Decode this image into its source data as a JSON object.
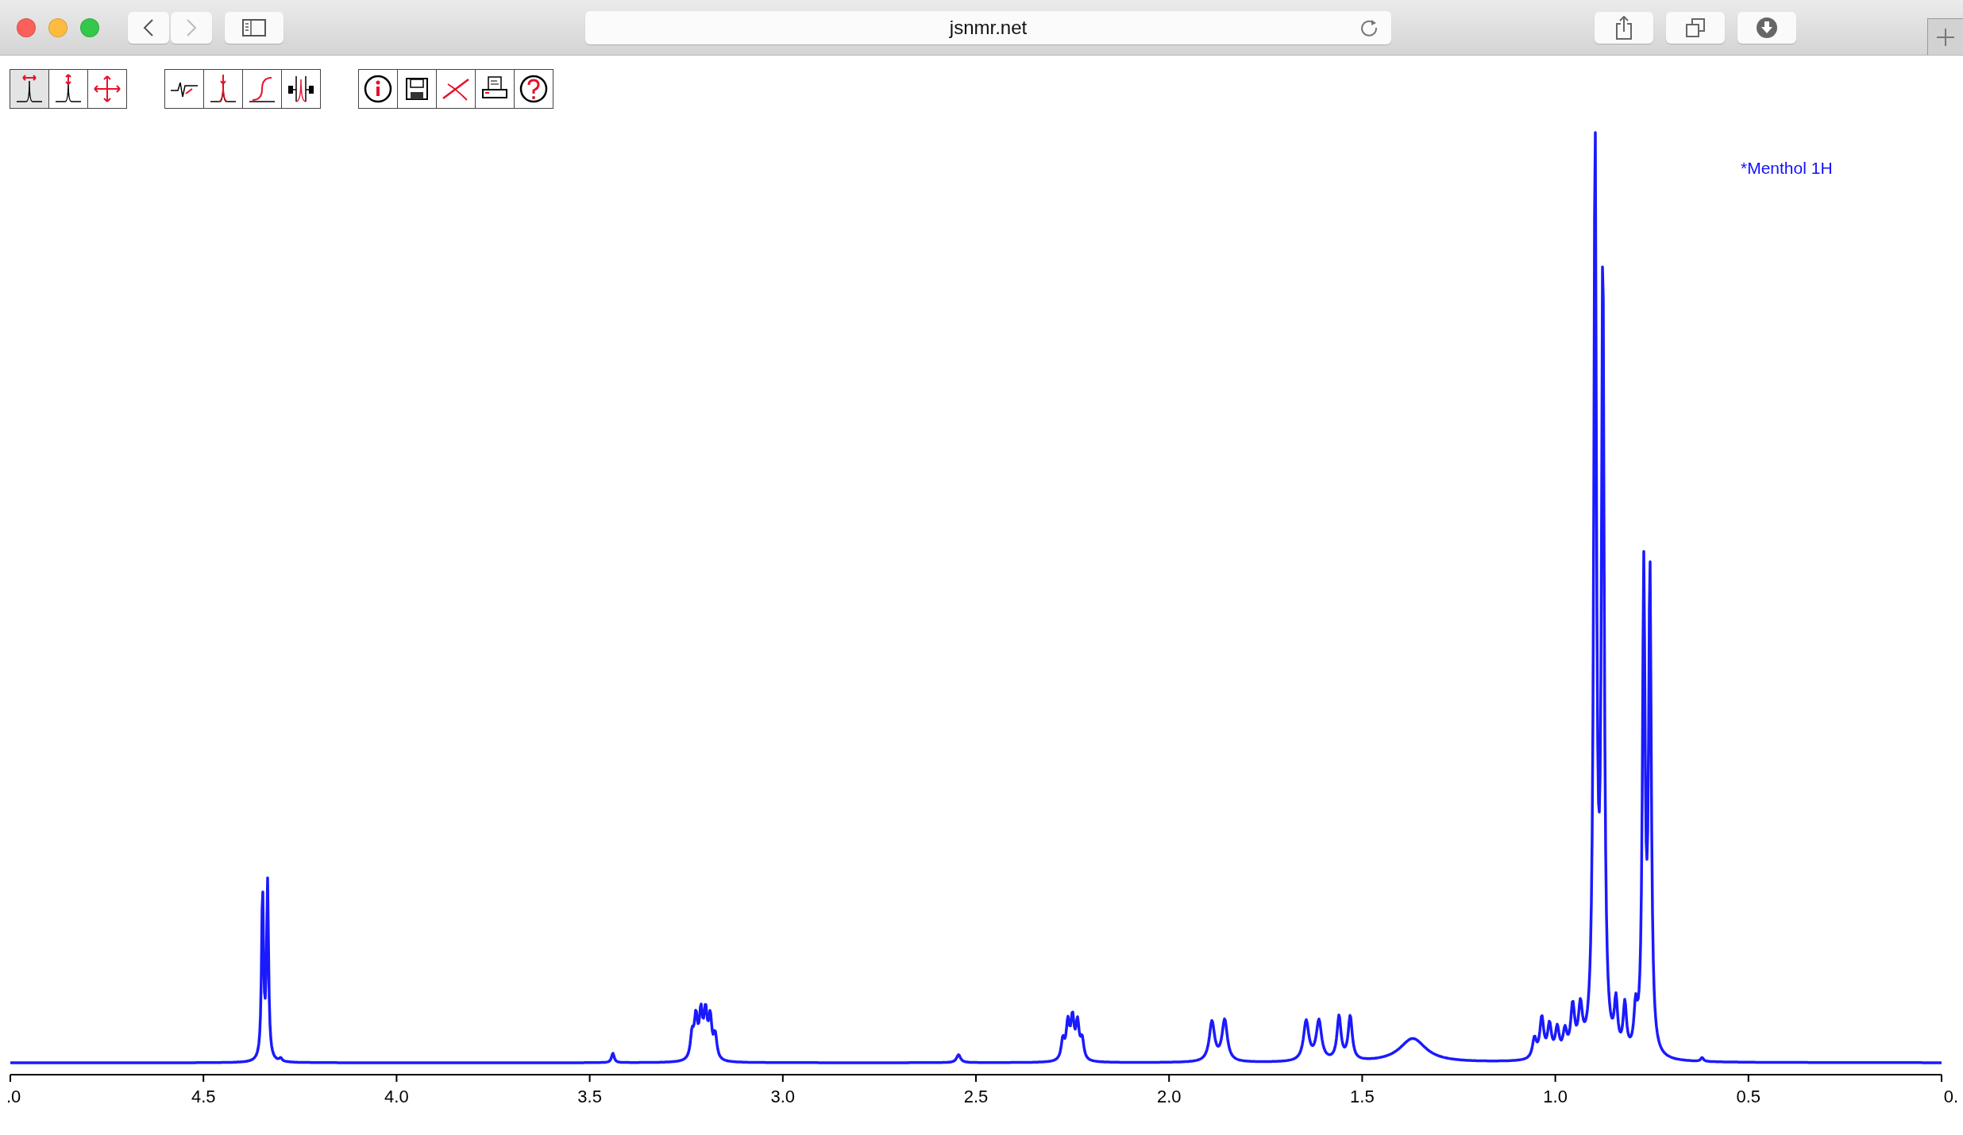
{
  "browser": {
    "url": "jsnmr.net"
  },
  "toolbar": {
    "groups": [
      {
        "buttons": [
          {
            "kind": "zoomx",
            "selected": true
          },
          {
            "kind": "zoomy",
            "selected": false
          },
          {
            "kind": "pan",
            "selected": false
          }
        ]
      },
      {
        "buttons": [
          {
            "kind": "phase",
            "selected": false
          },
          {
            "kind": "peak",
            "selected": false
          },
          {
            "kind": "integral",
            "selected": false
          },
          {
            "kind": "multiplet",
            "selected": false
          }
        ]
      },
      {
        "buttons": [
          {
            "kind": "info",
            "selected": false
          },
          {
            "kind": "save",
            "selected": false
          },
          {
            "kind": "clear",
            "selected": false
          },
          {
            "kind": "print",
            "selected": false
          },
          {
            "kind": "help",
            "selected": false
          }
        ]
      }
    ]
  },
  "spectrum": {
    "title": "*Menthol 1H",
    "x_tick_labels": [
      ".0",
      "4.5",
      "4.0",
      "3.5",
      "3.0",
      "2.5",
      "2.0",
      "1.5",
      "1.0",
      "0.5",
      "0."
    ]
  }
}
